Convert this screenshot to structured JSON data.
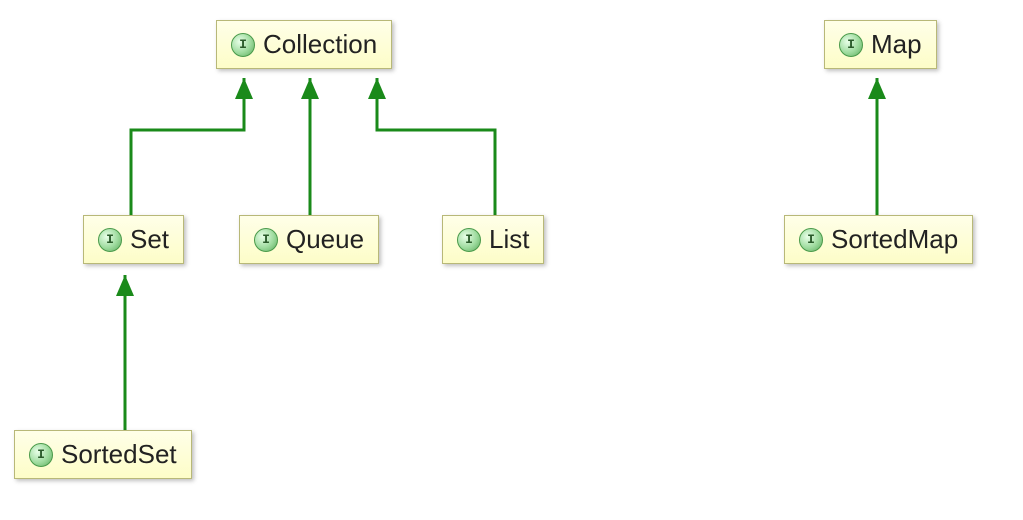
{
  "diagram": {
    "nodes": {
      "collection": {
        "label": "Collection",
        "icon_letter": "I"
      },
      "set": {
        "label": "Set",
        "icon_letter": "I"
      },
      "queue": {
        "label": "Queue",
        "icon_letter": "I"
      },
      "list": {
        "label": "List",
        "icon_letter": "I"
      },
      "sortedset": {
        "label": "SortedSet",
        "icon_letter": "I"
      },
      "map": {
        "label": "Map",
        "icon_letter": "I"
      },
      "sortedmap": {
        "label": "SortedMap",
        "icon_letter": "I"
      }
    },
    "edges": [
      {
        "from": "set",
        "to": "collection"
      },
      {
        "from": "queue",
        "to": "collection"
      },
      {
        "from": "list",
        "to": "collection"
      },
      {
        "from": "sortedset",
        "to": "set"
      },
      {
        "from": "sortedmap",
        "to": "map"
      }
    ],
    "colors": {
      "arrow": "#1a8a1a",
      "node_fill_top": "#ffffe8",
      "node_fill_bottom": "#fdfdc8",
      "node_border": "#b8b878"
    }
  }
}
